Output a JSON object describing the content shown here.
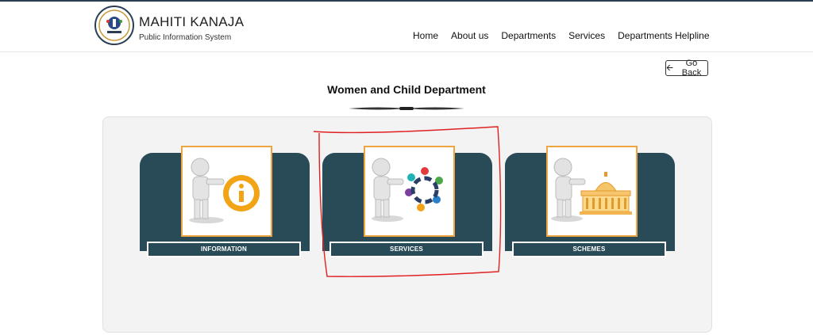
{
  "brand": {
    "title": "MAHITI KANAJA",
    "subtitle": "Public Information System",
    "logo_icon": "mahiti-kanaja-seal"
  },
  "nav": {
    "items": [
      {
        "label": "Home"
      },
      {
        "label": "About us"
      },
      {
        "label": "Departments"
      },
      {
        "label": "Services"
      },
      {
        "label": "Departments Helpline"
      }
    ]
  },
  "go_back": {
    "label": "Go Back",
    "icon": "arrow-left-icon"
  },
  "page": {
    "title": "Women and Child Department"
  },
  "cards": [
    {
      "label": "INFORMATION",
      "icon": "info-icon"
    },
    {
      "label": "SERVICES",
      "icon": "people-circle-icon"
    },
    {
      "label": "SCHEMES",
      "icon": "government-building-icon"
    }
  ],
  "colors": {
    "card_bg": "#284b57",
    "frame_border": "#f0a640",
    "annotation": "#e02020"
  }
}
